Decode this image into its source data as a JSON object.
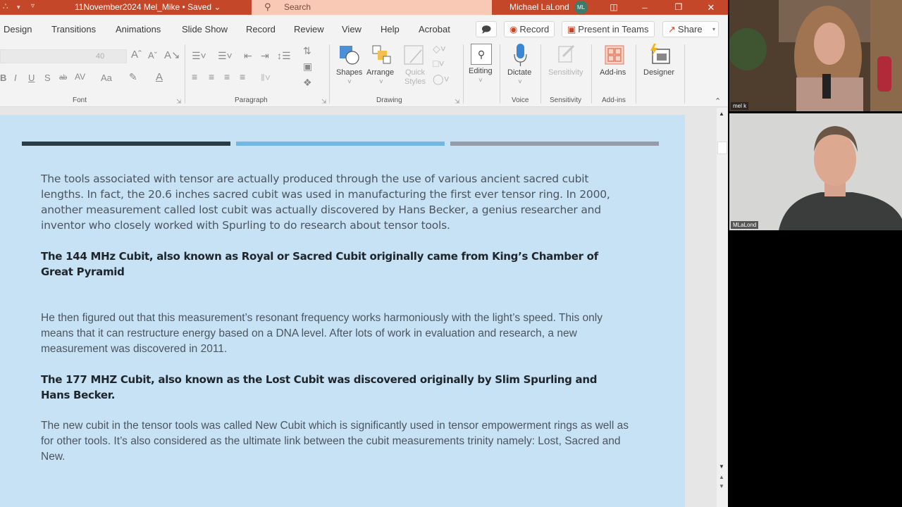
{
  "titlebar": {
    "app_icon": "powerpoint-loop-icon",
    "doc_title": "11November2024 Mel_Mike • Saved ⌄",
    "search_placeholder": "Search",
    "user_name": "Michael LaLond",
    "user_initials": "ML"
  },
  "tabs": [
    "Design",
    "Transitions",
    "Animations",
    "Slide Show",
    "Record",
    "Review",
    "View",
    "Help",
    "Acrobat"
  ],
  "tab_actions": {
    "comments_icon": "comment-icon",
    "record_label": "Record",
    "present_label": "Present in Teams",
    "share_label": "Share"
  },
  "ribbon": {
    "font": {
      "size_value": "40",
      "group_label": "Font",
      "buttons": [
        "B",
        "I",
        "U",
        "S",
        "ab",
        "AV",
        "Aa",
        "A",
        "A"
      ]
    },
    "paragraph": {
      "group_label": "Paragraph"
    },
    "drawing": {
      "group_label": "Drawing",
      "shapes_label": "Shapes",
      "arrange_label": "Arrange",
      "quick_styles_label": "Quick Styles"
    },
    "editing": {
      "label": "Editing"
    },
    "voice": {
      "label": "Dictate",
      "group_label": "Voice"
    },
    "sensitivity": {
      "label": "Sensitivity",
      "group_label": "Sensitivity"
    },
    "addins": {
      "label": "Add-ins",
      "group_label": "Add-ins"
    },
    "designer": {
      "label": "Designer"
    }
  },
  "slide": {
    "bar_colors": [
      "#2a3d45",
      "#72b6e4",
      "#959ba8"
    ],
    "paragraph1": "The tools associated with tensor are actually produced through the use of various ancient sacred cubit lengths. In fact, the 20.6 inches sacred cubit was used in manufacturing the first ever tensor ring. In 2000, another measurement called lost cubit was actually discovered by Hans Becker, a genius researcher and inventor who closely worked with Spurling to do research about tensor tools.",
    "heading1": "The 144 MHz Cubit, also known as Royal or Sacred Cubit originally came from King’s Chamber of Great Pyramid",
    "paragraph2": "He then figured out that this measurement’s resonant frequency works harmoniously with the light’s speed. This only means that it can restructure energy based on a DNA level. After lots of work in evaluation and research, a new measurement was discovered in 2011.",
    "heading2": "The 177 MHZ Cubit, also known as the Lost Cubit was discovered originally by Slim Spurling and Hans Becker.",
    "paragraph3": "The new cubit in the tensor tools was called New Cubit which is significantly used in tensor empowerment rings as well as for other tools. It’s also considered as the ultimate link between the cubit measurements trinity namely: Lost, Sacred and New."
  },
  "video": {
    "participant1": "mel k",
    "participant2": "MLaLond"
  }
}
